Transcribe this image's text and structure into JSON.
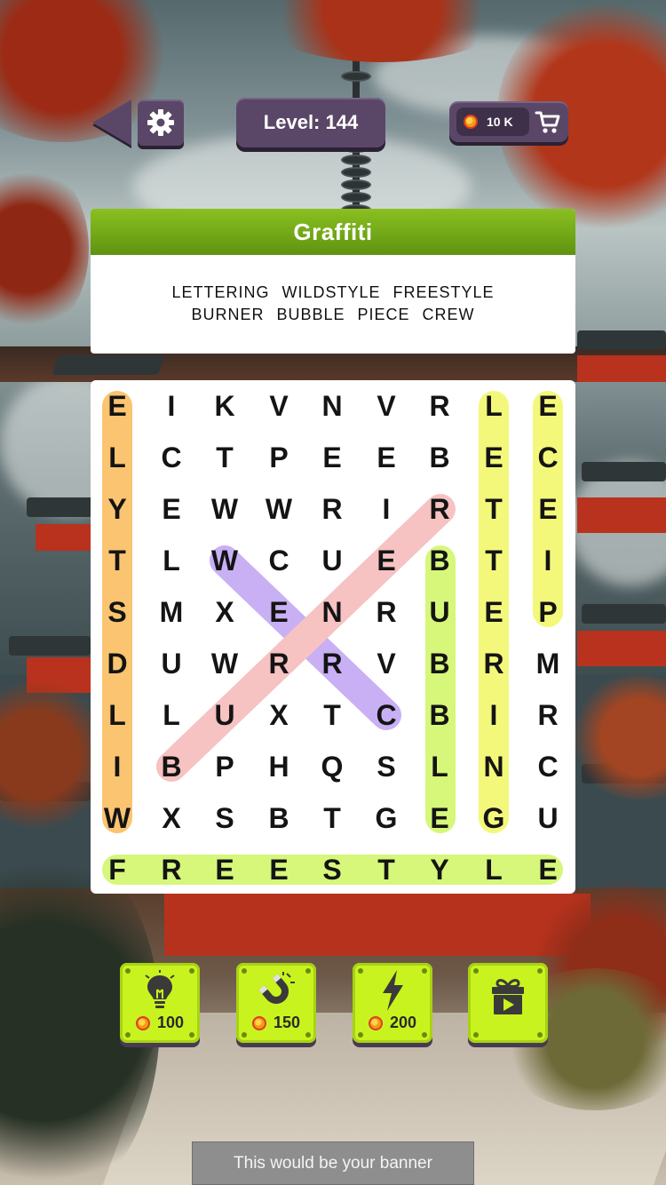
{
  "header": {
    "level_text": "Level: 144",
    "coins": "10 K"
  },
  "theme": {
    "title": "Graffiti",
    "words_row1": [
      "LETTERING",
      "WILDSTYLE",
      "FREESTYLE"
    ],
    "words_row2": [
      "BURNER",
      "BUBBLE",
      "PIECE",
      "CREW"
    ]
  },
  "grid": {
    "rows": [
      [
        "E",
        "I",
        "K",
        "V",
        "N",
        "V",
        "R",
        "L",
        "E"
      ],
      [
        "L",
        "C",
        "T",
        "P",
        "E",
        "E",
        "B",
        "E",
        "C"
      ],
      [
        "Y",
        "E",
        "W",
        "W",
        "R",
        "I",
        "R",
        "T",
        "E"
      ],
      [
        "T",
        "L",
        "W",
        "C",
        "U",
        "E",
        "B",
        "T",
        "I"
      ],
      [
        "S",
        "M",
        "X",
        "E",
        "N",
        "R",
        "U",
        "E",
        "P"
      ],
      [
        "D",
        "U",
        "W",
        "R",
        "R",
        "V",
        "B",
        "R",
        "M"
      ],
      [
        "L",
        "L",
        "U",
        "X",
        "T",
        "C",
        "B",
        "I",
        "R"
      ],
      [
        "I",
        "B",
        "P",
        "H",
        "Q",
        "S",
        "L",
        "N",
        "C"
      ],
      [
        "W",
        "X",
        "S",
        "B",
        "T",
        "G",
        "E",
        "G",
        "U"
      ],
      [
        "F",
        "R",
        "E",
        "E",
        "S",
        "T",
        "Y",
        "L",
        "E"
      ]
    ],
    "found": [
      {
        "word": "WILDSTYLE",
        "color": "#fbc471"
      },
      {
        "word": "LETTERING",
        "color": "#f4f87a"
      },
      {
        "word": "PIECE",
        "color": "#f4f87a"
      },
      {
        "word": "BUBBLE",
        "color": "#d6f77a"
      },
      {
        "word": "FREESTYLE",
        "color": "#d6f77a"
      },
      {
        "word": "CREW",
        "color": "#c9b0f5"
      },
      {
        "word": "BURNER",
        "color": "#f7c2c2"
      }
    ]
  },
  "powerups": [
    {
      "icon": "lightbulb-icon",
      "price": "100"
    },
    {
      "icon": "magnet-icon",
      "price": "150"
    },
    {
      "icon": "lightning-icon",
      "price": "200"
    },
    {
      "icon": "gift-video-icon",
      "price": ""
    }
  ],
  "banner": {
    "text": "This would be your banner"
  }
}
